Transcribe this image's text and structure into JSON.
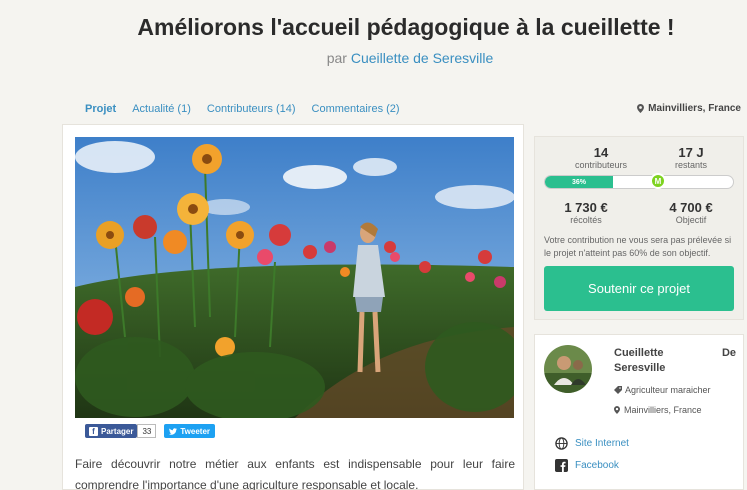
{
  "header": {
    "title": "Améliorons l'accueil pédagogique à la cueillette !",
    "by_prefix": "par",
    "author": "Cueillette de Seresville"
  },
  "tabs": [
    {
      "label": "Projet"
    },
    {
      "label": "Actualité (1)"
    },
    {
      "label": "Contributeurs (14)"
    },
    {
      "label": "Commentaires (2)"
    }
  ],
  "location": "Mainvilliers, France",
  "share": {
    "facebook_label": "Partager",
    "facebook_count": "33",
    "twitter_label": "Tweeter"
  },
  "description": "Faire découvrir notre métier aux enfants est indispensable pour leur faire comprendre l'importance d'une agriculture responsable et locale.",
  "stats": {
    "contributors_value": "14",
    "contributors_label": "contributeurs",
    "days_value": "17 J",
    "days_label": "restants",
    "progress_label": "36%",
    "progress_fraction": 0.36,
    "milestone_label": "M",
    "collected_value": "1 730 €",
    "collected_label": "récoltés",
    "goal_value": "4 700 €",
    "goal_label": "Objectif",
    "note": "Votre contribution ne vous sera pas prélevée si le projet n'atteint pas 60% de son objectif.",
    "support_button": "Soutenir ce projet"
  },
  "organizer": {
    "name_part1": "Cueillette",
    "name_part2": "De",
    "name_part3": "Seresville",
    "role": "Agriculteur maraicher",
    "location": "Mainvilliers, France",
    "website_label": "Site Internet",
    "facebook_label": "Facebook"
  },
  "colors": {
    "accent": "#2bbf8f",
    "link": "#3a8fc1",
    "facebook": "#3b5998",
    "twitter": "#1da1f2"
  }
}
